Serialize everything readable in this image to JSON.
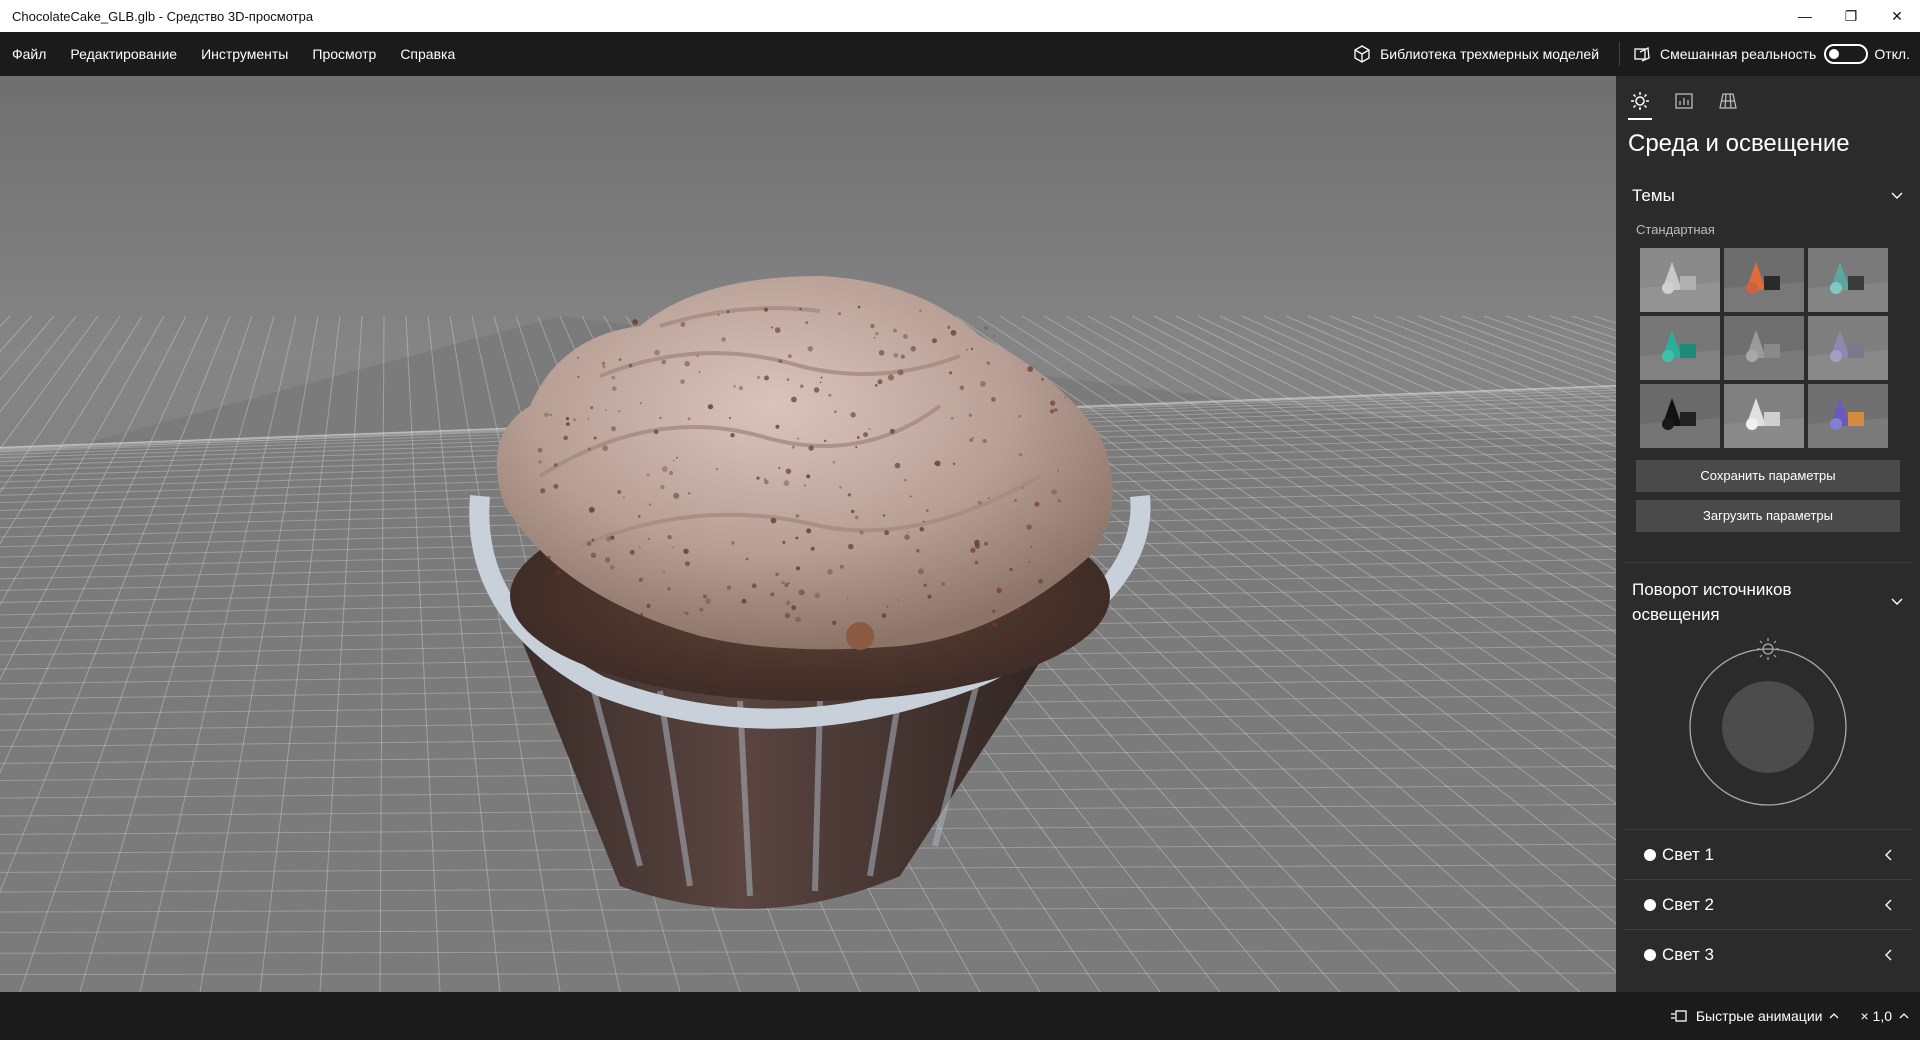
{
  "window": {
    "title": "ChocolateCake_GLB.glb - Средство 3D-просмотра",
    "minimize": "—",
    "restore": "❐",
    "close": "✕"
  },
  "menu": {
    "items": [
      "Файл",
      "Редактирование",
      "Инструменты",
      "Просмотр",
      "Справка"
    ],
    "library": "Библиотека трехмерных моделей",
    "mixed_reality": "Смешанная реальность",
    "toggle_state": "Откл."
  },
  "panel": {
    "tabs": [
      "sun-icon",
      "stats-icon",
      "grid-icon"
    ],
    "title": "Среда и освещение",
    "themes": {
      "label": "Темы",
      "sublabel": "Стандартная",
      "count": 9
    },
    "save_button": "Сохранить параметры",
    "load_button": "Загрузить параметры",
    "rotation_label": "Поворот источников освещения",
    "lights": [
      "Свет 1",
      "Свет 2",
      "Свет 3"
    ]
  },
  "status": {
    "animations": "Быстрые анимации",
    "speed": "× 1,0"
  },
  "colors": {
    "viewport_bg": "#7a7a7a",
    "panel_bg": "#2b2b2b",
    "menubar_bg": "#1b1b1b",
    "button_bg": "#4a4a4a"
  }
}
